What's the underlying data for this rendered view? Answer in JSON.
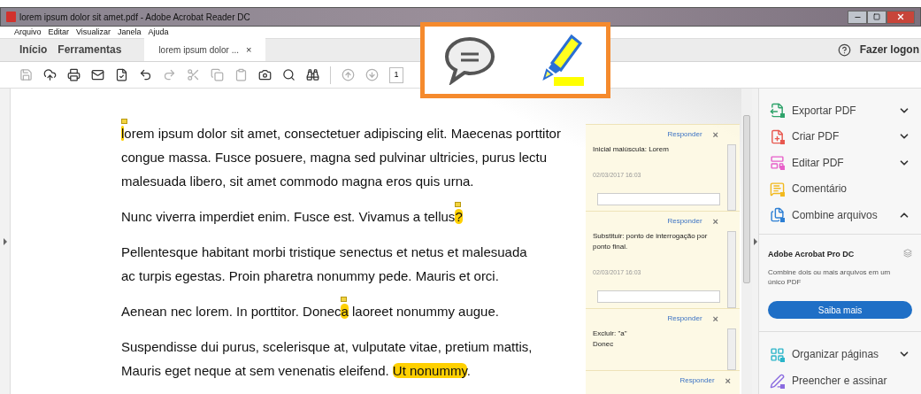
{
  "window": {
    "title": "lorem ipsum dolor sit amet.pdf - Adobe Acrobat Reader DC"
  },
  "menu": [
    "Arquivo",
    "Editar",
    "Visualizar",
    "Janela",
    "Ajuda"
  ],
  "tabs": [
    {
      "label": "Início",
      "kind": "home",
      "selected": false
    },
    {
      "label": "Ferramentas",
      "kind": "home",
      "selected": false
    },
    {
      "label": "lorem ipsum dolor ...",
      "close": "×",
      "kind": "document",
      "selected": true
    }
  ],
  "help_link": "Fazer logon",
  "toolbar": [
    {
      "kind": "save",
      "disabled": true
    },
    {
      "kind": "upload",
      "disabled": false
    },
    {
      "kind": "print",
      "disabled": false
    },
    {
      "kind": "mail",
      "disabled": false
    },
    {
      "kind": "certify",
      "disabled": false
    },
    {
      "kind": "undo",
      "disabled": false
    },
    {
      "kind": "redo",
      "disabled": true
    },
    {
      "kind": "cut",
      "disabled": true
    },
    {
      "kind": "copy",
      "disabled": true
    },
    {
      "kind": "paste",
      "disabled": true
    },
    {
      "kind": "snapshot",
      "disabled": false
    },
    {
      "kind": "search",
      "disabled": false
    },
    {
      "kind": "find",
      "disabled": false
    },
    {
      "kind": "prev",
      "disabled": true
    },
    {
      "kind": "next",
      "disabled": true
    }
  ],
  "page_field": "1",
  "document": {
    "paragraphs": [
      [
        [
          {
            "kind": "highlight_note",
            "text": "l"
          },
          {
            "kind": "plain",
            "text": "orem ipsum dolor sit amet, consectetuer adipiscing elit. Maecenas porttitor"
          }
        ],
        [
          {
            "kind": "plain",
            "text": "congue massa. Fusce posuere, magna sed pulvinar ultricies, purus lectu"
          }
        ],
        [
          {
            "kind": "plain",
            "text": "malesuada libero, sit amet commodo magna eros quis urna."
          }
        ]
      ],
      [
        [
          {
            "kind": "plain",
            "text": "Nunc viverra imperdiet enim. Fusce est. Vivamus a tellus"
          },
          {
            "kind": "highlight_note",
            "text": "?"
          }
        ]
      ],
      [
        [
          {
            "kind": "plain",
            "text": "Pellentesque habitant morbi tristique senectus et netus et malesuada"
          }
        ],
        [
          {
            "kind": "plain",
            "text": "ac turpis egestas. Proin pharetra nonummy pede. Mauris et orci."
          }
        ]
      ],
      [
        [
          {
            "kind": "plain",
            "text": "Aenean nec lorem. In porttitor. Donec"
          },
          {
            "kind": "highlight_note",
            "text": "a"
          },
          {
            "kind": "plain",
            "text": " laoreet nonummy augue."
          }
        ]
      ],
      [
        [
          {
            "kind": "plain",
            "text": "Suspendisse dui purus, scelerisque at, vulputate vitae, pretium mattis,"
          }
        ],
        [
          {
            "kind": "plain",
            "text": "Mauris eget neque at sem venenatis eleifend. "
          },
          {
            "kind": "highlight",
            "text": "Ut nonummy"
          },
          {
            "kind": "plain",
            "text": "."
          }
        ]
      ]
    ]
  },
  "comments": [
    {
      "reply": "Responder",
      "close": "×",
      "body": [
        "Inicial maiúscula: Lorem"
      ],
      "date": "02/03/2017  16:03"
    },
    {
      "reply": "Responder",
      "close": "×",
      "body": [
        "Substituir: ponto de interrogação por ponto final."
      ],
      "date": "02/03/2017  16:03"
    },
    {
      "reply": "Responder",
      "close": "×",
      "body": [
        "Excluir: \"a\"",
        "Donec"
      ]
    },
    {
      "reply": "Responder",
      "close": "×"
    }
  ],
  "tools_pane": {
    "items_top": [
      {
        "label": "Exportar PDF",
        "kind": "group",
        "expanded": false,
        "color": "#2fa36b"
      },
      {
        "label": "Criar PDF",
        "kind": "group",
        "expanded": false,
        "color": "#e8584f"
      },
      {
        "label": "Editar PDF",
        "kind": "group",
        "expanded": false,
        "color": "#e85fc9"
      },
      {
        "label": "Comentário",
        "kind": "tool",
        "color": "#f2b91e"
      },
      {
        "label": "Combine arquivos",
        "kind": "group",
        "expanded": true,
        "color": "#2d7fd4"
      }
    ],
    "promo": {
      "title": "Adobe Acrobat Pro DC",
      "text": "Combine dois ou mais arquivos em um único PDF",
      "button": "Saiba mais"
    },
    "items_bottom": [
      {
        "label": "Organizar páginas",
        "kind": "group",
        "expanded": false,
        "color": "#2bb5c9"
      },
      {
        "label": "Preencher e assinar",
        "kind": "tool",
        "color": "#8a6be0"
      }
    ]
  }
}
